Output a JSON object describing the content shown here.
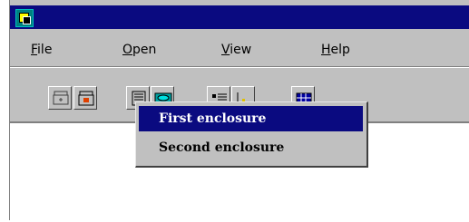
{
  "menubar": {
    "items": [
      {
        "label": "File",
        "mnemonic": "F",
        "rest": "ile"
      },
      {
        "label": "Open",
        "mnemonic": "O",
        "rest": "pen"
      },
      {
        "label": "View",
        "mnemonic": "V",
        "rest": "iew"
      },
      {
        "label": "Help",
        "mnemonic": "H",
        "rest": "elp"
      }
    ]
  },
  "toolbar": {
    "buttons": [
      {
        "icon": "disk-drive-icon"
      },
      {
        "icon": "disk-drive-alert-icon"
      },
      {
        "icon": "enclosure-icon"
      },
      {
        "icon": "storage-device-icon"
      },
      {
        "icon": "list-view-icon"
      },
      {
        "icon": "chart-view-icon"
      },
      {
        "icon": "grid-view-icon"
      }
    ]
  },
  "popup": {
    "items": [
      {
        "label": "First enclosure",
        "selected": true
      },
      {
        "label": "Second enclosure",
        "selected": false
      }
    ]
  },
  "colors": {
    "titlebar": "#0a0a80",
    "window": "#c0c0c0",
    "selection": "#0a0a80"
  }
}
